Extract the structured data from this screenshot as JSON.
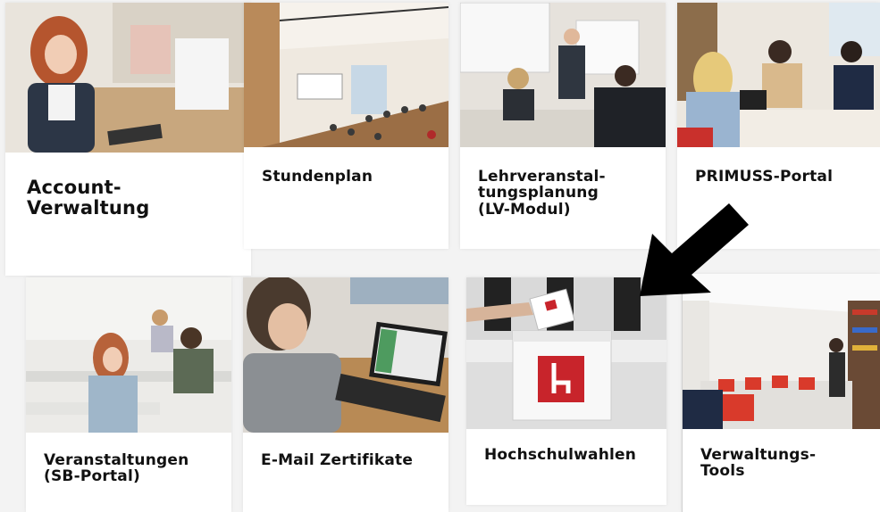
{
  "tiles": [
    {
      "title": "Account-\nVerwaltung",
      "photo": "woman-at-computer"
    },
    {
      "title": "Stundenplan",
      "photo": "lecture-hall"
    },
    {
      "title": "Lehrveranstal-\ntungsplanung\n(LV-Modul)",
      "photo": "teacher-at-whiteboard"
    },
    {
      "title": "PRIMUSS-Portal",
      "photo": "students-at-library-table"
    },
    {
      "title": "Veranstaltungen\n(SB-Portal)",
      "photo": "students-taking-exam"
    },
    {
      "title": "E-Mail Zertifikate",
      "photo": "person-using-laptop"
    },
    {
      "title": "Hochschulwahlen",
      "photo": "ballot-box-hochschule-landshut"
    },
    {
      "title": "Verwaltungs-\nTools",
      "photo": "library-with-red-chairs"
    }
  ],
  "annotation": {
    "icon": "pointing-arrow",
    "color": "#000000"
  },
  "colors": {
    "ballot_red": "#c8242b",
    "chair_red": "#d93a2b"
  }
}
